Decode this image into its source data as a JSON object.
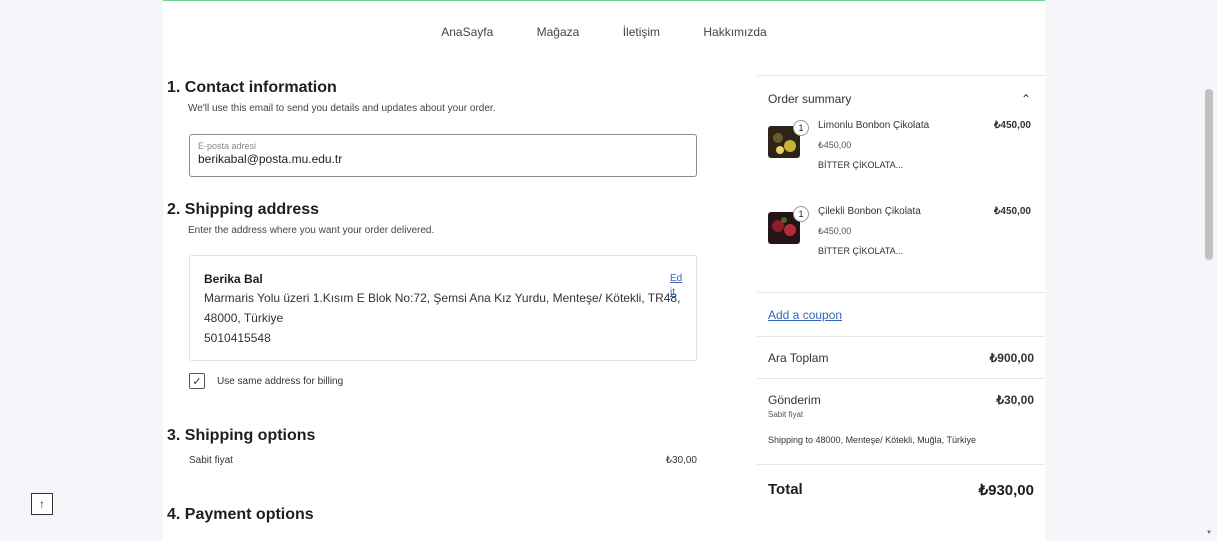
{
  "nav": [
    "AnaSayfa",
    "Mağaza",
    "İletişim",
    "Hakkımızda"
  ],
  "contact": {
    "title": "1. Contact information",
    "desc": "We'll use this email to send you details and updates about your order.",
    "email_label": "E-posta adresi",
    "email_value": "berikabal@posta.mu.edu.tr"
  },
  "shipping": {
    "title": "2. Shipping address",
    "desc": "Enter the address where you want your order delivered.",
    "name": "Berika Bal",
    "address": "Marmaris Yolu üzeri 1.Kısım E Blok No:72, Şemsi Ana Kız Yurdu, Menteşe/ Kötekli, TR48, 48000, Türkiye",
    "phone": "5010415548",
    "edit": "Edit",
    "billing_label": "Use same address for billing",
    "billing_checked": true
  },
  "options": {
    "title": "3. Shipping options",
    "method": "Sabit fiyat",
    "price": "₺30,00"
  },
  "payment": {
    "title": "4. Payment options"
  },
  "summary": {
    "title": "Order summary",
    "items": [
      {
        "qty": "1",
        "name": "Limonlu Bonbon Çikolata",
        "price": "₺450,00",
        "unit_price": "₺450,00",
        "desc": "BİTTER ÇİKOLATA..."
      },
      {
        "qty": "1",
        "name": "Çilekli Bonbon Çikolata",
        "price": "₺450,00",
        "unit_price": "₺450,00",
        "desc": "BİTTER ÇİKOLATA..."
      }
    ],
    "coupon": "Add a coupon",
    "subtotal_label": "Ara Toplam",
    "subtotal": "₺900,00",
    "shipping_label": "Gönderim",
    "shipping_price": "₺30,00",
    "shipping_method": "Sabit fiyat",
    "shipping_to": "Shipping to 48000, Menteşe/ Kötekli, Muğla, Türkiye",
    "total_label": "Total",
    "total": "₺930,00"
  },
  "colors": {
    "link": "#3466b8",
    "accent_top": "#6fcf8a"
  }
}
